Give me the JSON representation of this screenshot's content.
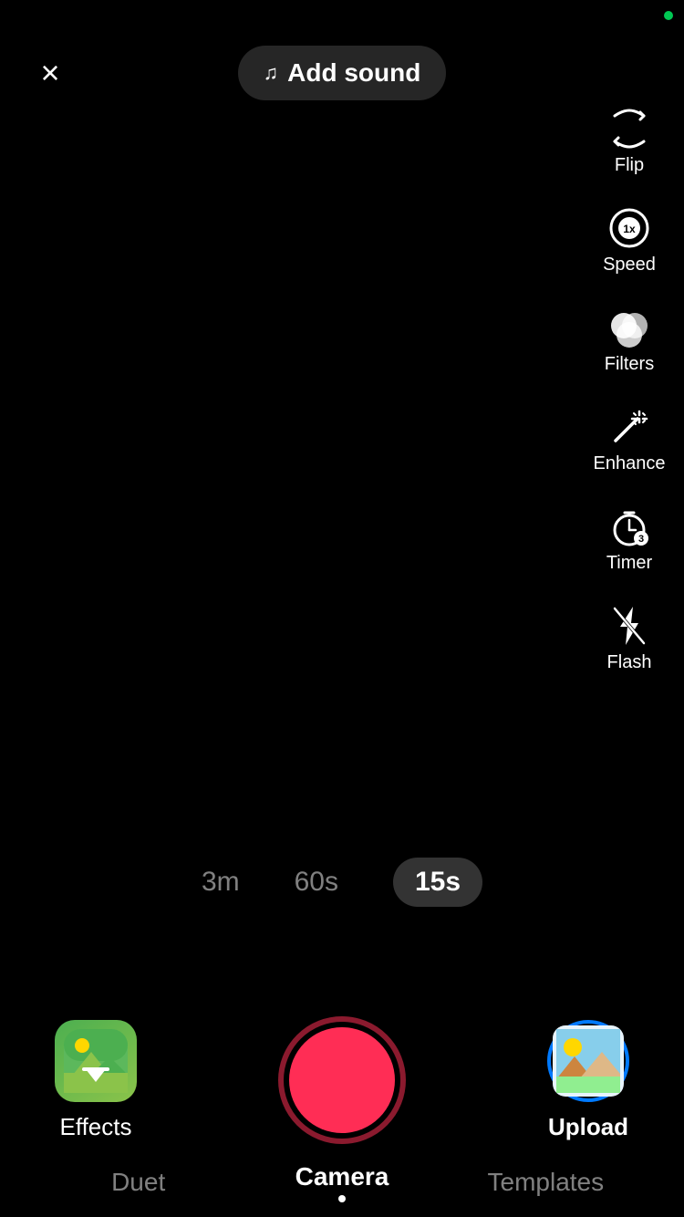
{
  "header": {
    "close_label": "×",
    "add_sound_label": "Add sound",
    "music_icon": "♫"
  },
  "controls": {
    "flip": {
      "label": "Flip"
    },
    "speed": {
      "label": "Speed",
      "value": "1x"
    },
    "filters": {
      "label": "Filters"
    },
    "enhance": {
      "label": "Enhance"
    },
    "timer": {
      "label": "Timer",
      "value": "3"
    },
    "flash": {
      "label": "Flash"
    }
  },
  "duration": {
    "options": [
      "3m",
      "60s",
      "15s"
    ],
    "active": "15s"
  },
  "bottom": {
    "effects_label": "Effects",
    "upload_label": "Upload",
    "tabs": [
      {
        "label": "Duet",
        "active": false
      },
      {
        "label": "Camera",
        "active": true
      },
      {
        "label": "Templates",
        "active": false
      }
    ]
  },
  "status": {
    "dot_color": "#00C853"
  }
}
